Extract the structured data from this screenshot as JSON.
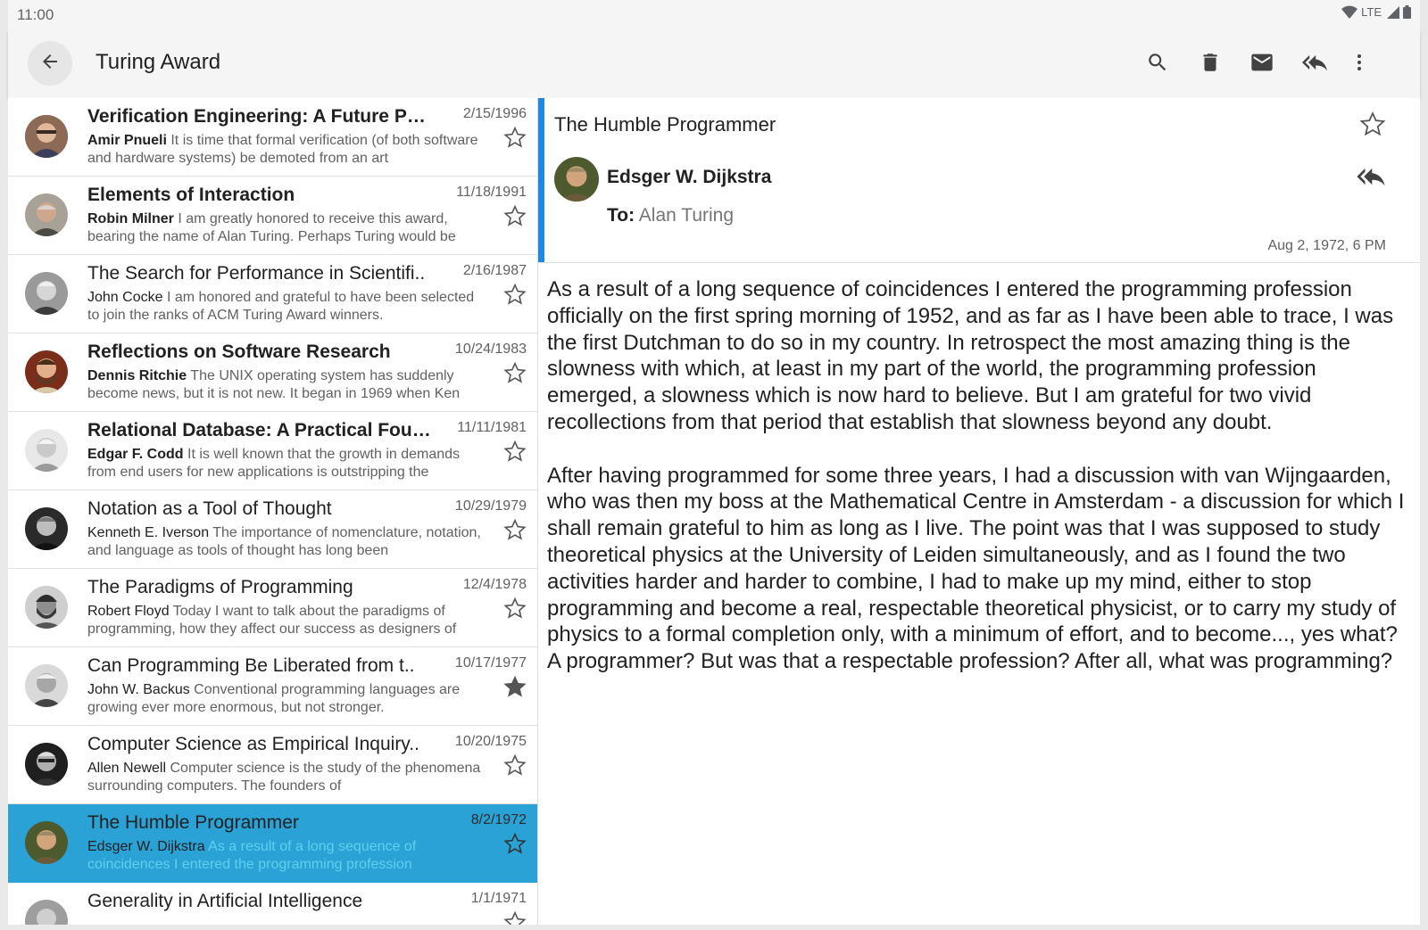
{
  "status_bar": {
    "time": "11:00",
    "network": "LTE"
  },
  "toolbar": {
    "title": "Turing Award",
    "icons": [
      "back-arrow-icon",
      "search-icon",
      "delete-icon",
      "mail-icon",
      "reply-all-icon",
      "more-vert-icon"
    ]
  },
  "messages": [
    {
      "subject": "Verification Engineering: A Future Prof..",
      "date": "2/15/1996",
      "from": "Amir Pnueli",
      "preview": "It is time that formal verification (of both software and hardware systems) be demoted from an art",
      "unread": true,
      "starred": false,
      "selected": false
    },
    {
      "subject": "Elements of Interaction",
      "date": "11/18/1991",
      "from": "Robin Milner",
      "preview": "I am greatly honored to receive this award, bearing the name of Alan Turing. Perhaps Turing would be",
      "unread": true,
      "starred": false,
      "selected": false
    },
    {
      "subject": "The Search for Performance in Scientifi..",
      "date": "2/16/1987",
      "from": "John Cocke",
      "preview": "I am honored and grateful to have been selected to join the ranks of ACM Turing Award winners.",
      "unread": false,
      "starred": false,
      "selected": false
    },
    {
      "subject": "Reflections on Software Research",
      "date": "10/24/1983",
      "from": "Dennis Ritchie",
      "preview": "The UNIX operating system has suddenly become news, but it is not new. It began in 1969 when Ken",
      "unread": true,
      "starred": false,
      "selected": false
    },
    {
      "subject": "Relational Database: A Practical Foun..",
      "date": "11/11/1981",
      "from": "Edgar F. Codd",
      "preview": "It is well known that the growth in demands from end users for new applications is outstripping the",
      "unread": true,
      "starred": false,
      "selected": false
    },
    {
      "subject": "Notation as a Tool of Thought",
      "date": "10/29/1979",
      "from": "Kenneth E. Iverson",
      "preview": "The importance of nomenclature, notation, and language as tools of thought has long been",
      "unread": false,
      "starred": false,
      "selected": false
    },
    {
      "subject": "The Paradigms of Programming",
      "date": "12/4/1978",
      "from": "Robert Floyd",
      "preview": "Today I want to talk about the paradigms of programming, how they affect our success as designers of",
      "unread": false,
      "starred": false,
      "selected": false
    },
    {
      "subject": "Can Programming Be Liberated from t..",
      "date": "10/17/1977",
      "from": "John W. Backus",
      "preview": "Conventional programming languages are growing ever more enormous, but not stronger.",
      "unread": false,
      "starred": true,
      "selected": false
    },
    {
      "subject": "Computer Science as Empirical Inquiry..",
      "date": "10/20/1975",
      "from": "Allen Newell",
      "preview": "Computer science is the study of the phenomena surrounding computers. The founders of",
      "unread": false,
      "starred": false,
      "selected": false
    },
    {
      "subject": "The Humble Programmer",
      "date": "8/2/1972",
      "from": "Edsger W. Dijkstra",
      "preview": "As a result of a long sequence of coincidences I entered the programming profession",
      "unread": false,
      "starred": false,
      "selected": true
    },
    {
      "subject": "Generality in Artificial Intelligence",
      "date": "1/1/1971",
      "from": "",
      "preview": "",
      "unread": false,
      "starred": false,
      "selected": false
    }
  ],
  "detail": {
    "subject": "The Humble Programmer",
    "sender": "Edsger W. Dijkstra",
    "to_label": "To:",
    "to": "Alan Turing",
    "date": "Aug 2, 1972, 6 PM",
    "paragraphs": [
      "As a result of a long sequence of coincidences I entered the programming profession officially on the first spring morning of 1952, and as far as I have been able to trace, I was the first Dutchman to do so in my country. In retrospect the most amazing thing is the slowness with which, at least in my part of the world, the programming profession emerged, a slowness which is now hard to believe. But I am grateful for two vivid recollections from that period that establish that slowness beyond any doubt.",
      "After having programmed for some three years, I had a discussion with van Wijngaarden, who was then my boss at the Mathematical Centre in Amsterdam - a discussion for which I shall remain grateful to him as long as I live. The point was that I was supposed to study theoretical physics at the University of Leiden simultaneously, and as I found the two activities harder and harder to combine, I had to make up my mind, either to stop programming and become a real, respectable theoretical physicist, or to carry my study of physics to a formal completion only, with a minimum of effort, and to become..., yes what? A programmer? But was that a respectable profession? After all, what was programming?"
    ]
  },
  "colors": {
    "accent": "#1e88e5",
    "selected_row": "#2aa2d6",
    "toolbar": "#f5f5f5"
  }
}
